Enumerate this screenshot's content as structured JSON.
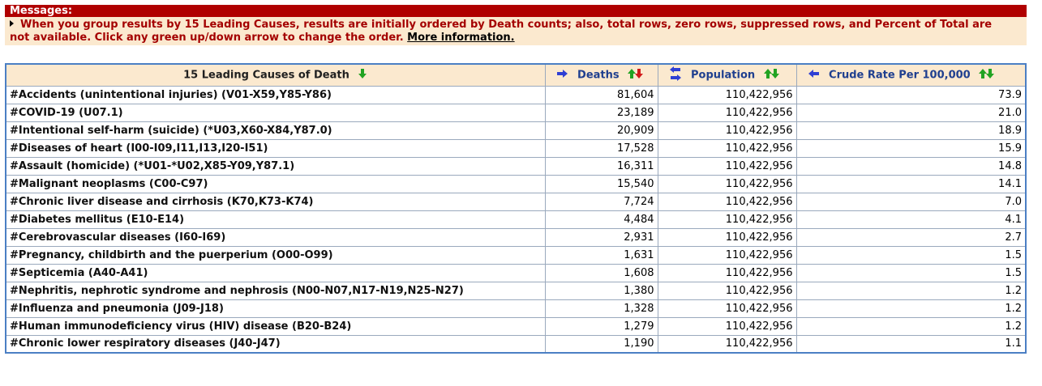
{
  "messages": {
    "header": "Messages:",
    "text": "When you group results by 15 Leading Causes, results are initially ordered by Death counts; also, total rows, zero rows, suppressed rows, and Percent of Total are not available. Click any green up/down arrow to change the order.",
    "link": "More information."
  },
  "table": {
    "headers": {
      "cause": "15 Leading Causes of Death",
      "deaths": "Deaths",
      "population": "Population",
      "rate": "Crude Rate Per 100,000"
    },
    "rows": [
      {
        "cause": "#Accidents (unintentional injuries) (V01-X59,Y85-Y86)",
        "deaths": "81,604",
        "population": "110,422,956",
        "rate": "73.9"
      },
      {
        "cause": "#COVID-19 (U07.1)",
        "deaths": "23,189",
        "population": "110,422,956",
        "rate": "21.0"
      },
      {
        "cause": "#Intentional self-harm (suicide) (*U03,X60-X84,Y87.0)",
        "deaths": "20,909",
        "population": "110,422,956",
        "rate": "18.9"
      },
      {
        "cause": "#Diseases of heart (I00-I09,I11,I13,I20-I51)",
        "deaths": "17,528",
        "population": "110,422,956",
        "rate": "15.9"
      },
      {
        "cause": "#Assault (homicide) (*U01-*U02,X85-Y09,Y87.1)",
        "deaths": "16,311",
        "population": "110,422,956",
        "rate": "14.8"
      },
      {
        "cause": "#Malignant neoplasms (C00-C97)",
        "deaths": "15,540",
        "population": "110,422,956",
        "rate": "14.1"
      },
      {
        "cause": "#Chronic liver disease and cirrhosis (K70,K73-K74)",
        "deaths": "7,724",
        "population": "110,422,956",
        "rate": "7.0"
      },
      {
        "cause": "#Diabetes mellitus (E10-E14)",
        "deaths": "4,484",
        "population": "110,422,956",
        "rate": "4.1"
      },
      {
        "cause": "#Cerebrovascular diseases (I60-I69)",
        "deaths": "2,931",
        "population": "110,422,956",
        "rate": "2.7"
      },
      {
        "cause": "#Pregnancy, childbirth and the puerperium (O00-O99)",
        "deaths": "1,631",
        "population": "110,422,956",
        "rate": "1.5"
      },
      {
        "cause": "#Septicemia (A40-A41)",
        "deaths": "1,608",
        "population": "110,422,956",
        "rate": "1.5"
      },
      {
        "cause": "#Nephritis, nephrotic syndrome and nephrosis (N00-N07,N17-N19,N25-N27)",
        "deaths": "1,380",
        "population": "110,422,956",
        "rate": "1.2"
      },
      {
        "cause": "#Influenza and pneumonia (J09-J18)",
        "deaths": "1,328",
        "population": "110,422,956",
        "rate": "1.2"
      },
      {
        "cause": "#Human immunodeficiency virus (HIV) disease (B20-B24)",
        "deaths": "1,279",
        "population": "110,422,956",
        "rate": "1.2"
      },
      {
        "cause": "#Chronic lower respiratory diseases (J40-J47)",
        "deaths": "1,190",
        "population": "110,422,956",
        "rate": "1.1"
      }
    ]
  },
  "icons": {
    "sort": "sort-up-down-icon",
    "move_right": "arrow-right-icon",
    "swap": "swap-vertical-icon",
    "move_left": "arrow-left-icon"
  },
  "colors": {
    "message_header_bg": "#b00000",
    "message_bg": "#fbe9cf",
    "message_text": "#a40000",
    "header_bg": "#fbe9cf",
    "border_blue": "#4b7fc4",
    "sort_green": "#22a322",
    "sort_red": "#d21a1a",
    "nav_blue": "#2f3fd4"
  }
}
